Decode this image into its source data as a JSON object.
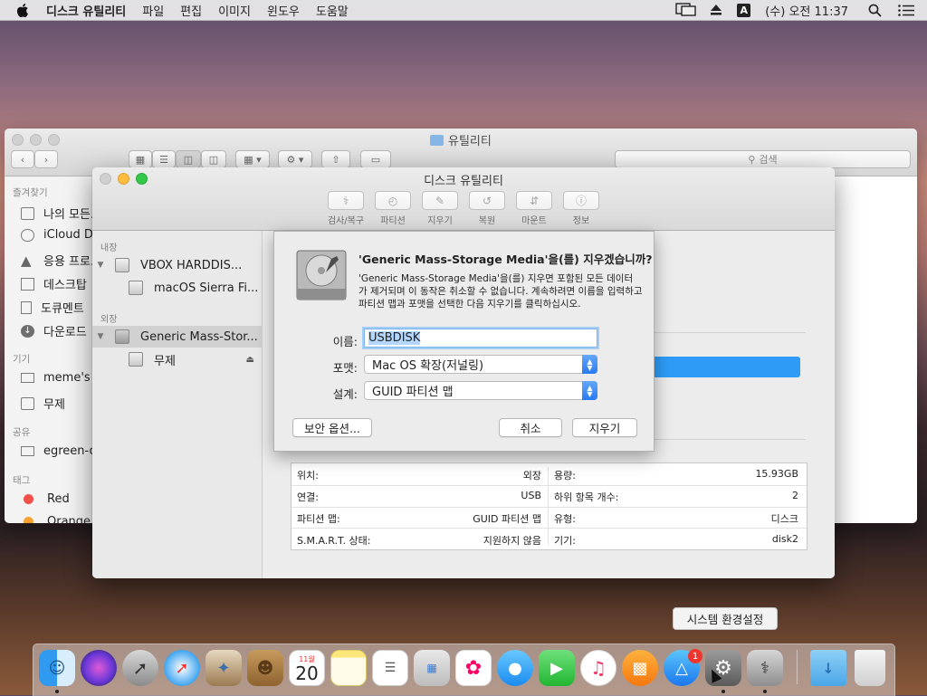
{
  "menubar": {
    "app_name": "디스크 유틸리티",
    "items": [
      "파일",
      "편집",
      "이미지",
      "윈도우",
      "도움말"
    ],
    "input_source": "A",
    "clock": "(수) 오전 11:37"
  },
  "finder": {
    "title": "유틸리티",
    "search_placeholder": "검색",
    "sidebar": {
      "favorites_header": "즐겨찾기",
      "favorites": [
        "나의 모든...",
        "iCloud Dr",
        "응용 프로...",
        "데스크탑",
        "도큐멘트",
        "다운로드"
      ],
      "devices_header": "기기",
      "devices": [
        "meme's i",
        "무제"
      ],
      "shared_header": "공유",
      "shared": [
        "egreen-o"
      ],
      "tags_header": "태그",
      "tags": [
        {
          "label": "Red",
          "color": "#f4504a"
        },
        {
          "label": "Orange",
          "color": "#f6a130"
        }
      ]
    }
  },
  "disk_utility": {
    "title": "디스크 유틸리티",
    "toolbar": [
      "검사/복구",
      "파티션",
      "지우기",
      "복원",
      "마운트",
      "정보"
    ],
    "sidebar": {
      "internal_header": "내장",
      "internal": [
        {
          "label": "VBOX HARDDIS...",
          "level": 0
        },
        {
          "label": "macOS Sierra Fi...",
          "level": 1
        }
      ],
      "external_header": "외장",
      "external": [
        {
          "label": "Generic Mass-Stor...",
          "level": 0,
          "selected": true
        },
        {
          "label": "무제",
          "level": 1
        }
      ]
    },
    "info": {
      "left": [
        {
          "k": "위치:",
          "v": "외장"
        },
        {
          "k": "연결:",
          "v": "USB"
        },
        {
          "k": "파티션 맵:",
          "v": "GUID 파티션 맵"
        },
        {
          "k": "S.M.A.R.T. 상태:",
          "v": "지원하지 않음"
        }
      ],
      "right": [
        {
          "k": "용량:",
          "v": "15.93GB"
        },
        {
          "k": "하위 항목 개수:",
          "v": "2"
        },
        {
          "k": "유형:",
          "v": "디스크"
        },
        {
          "k": "기기:",
          "v": "disk2"
        }
      ]
    }
  },
  "erase_sheet": {
    "heading": "'Generic Mass-Storage Media'을(를) 지우겠습니까?",
    "body_line1": "'Generic Mass-Storage Media'을(를) 지우면 포함된 모든 데이터",
    "body_line2": "가 제거되며 이 동작은 취소할 수 없습니다. 계속하려면 이름을 입력하고",
    "body_line3": "파티션 맵과 포맷을 선택한 다음 지우기를 클릭하십시오.",
    "name_label": "이름:",
    "name_value": "USBDISK",
    "format_label": "포맷:",
    "format_value": "Mac OS 확장(저널링)",
    "scheme_label": "설계:",
    "scheme_value": "GUID 파티션 맵",
    "security_button": "보안 옵션...",
    "cancel_button": "취소",
    "erase_button": "지우기"
  },
  "dock": {
    "tooltip": "시스템 환경설정",
    "calendar_month": "11월",
    "calendar_day": "20",
    "appstore_badge": "1"
  },
  "colors": {
    "accent_blue": "#2a79f1",
    "selection": "#b3d7ff"
  }
}
